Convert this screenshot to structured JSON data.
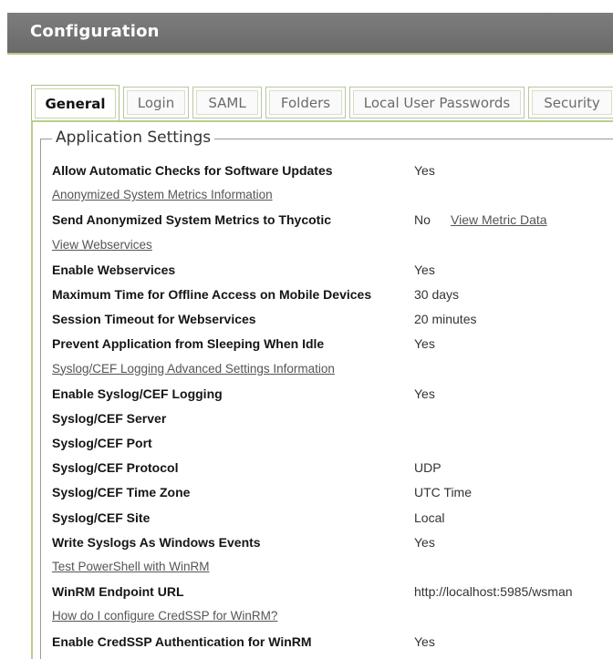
{
  "header": {
    "title": "Configuration"
  },
  "tabs": [
    {
      "label": "General",
      "active": true
    },
    {
      "label": "Login",
      "active": false
    },
    {
      "label": "SAML",
      "active": false
    },
    {
      "label": "Folders",
      "active": false
    },
    {
      "label": "Local User Passwords",
      "active": false
    },
    {
      "label": "Security",
      "active": false
    }
  ],
  "section": {
    "title": "Application Settings"
  },
  "settings": [
    {
      "label": "Allow Automatic Checks for Software Updates",
      "value": "Yes"
    },
    {
      "link": "Anonymized System Metrics Information"
    },
    {
      "label": "Send Anonymized System Metrics to Thycotic",
      "value": "No",
      "value_link": "View Metric Data"
    },
    {
      "link": "View Webservices"
    },
    {
      "label": "Enable Webservices",
      "value": "Yes"
    },
    {
      "label": "Maximum Time for Offline Access on Mobile Devices",
      "value": "30 days"
    },
    {
      "label": "Session Timeout for Webservices",
      "value": "20 minutes"
    },
    {
      "label": "Prevent Application from Sleeping When Idle",
      "value": "Yes"
    },
    {
      "link": "Syslog/CEF Logging Advanced Settings Information"
    },
    {
      "label": "Enable Syslog/CEF Logging",
      "value": "Yes"
    },
    {
      "label": "Syslog/CEF Server",
      "value": ""
    },
    {
      "label": "Syslog/CEF Port",
      "value": ""
    },
    {
      "label": "Syslog/CEF Protocol",
      "value": "UDP"
    },
    {
      "label": "Syslog/CEF Time Zone",
      "value": "UTC Time"
    },
    {
      "label": "Syslog/CEF Site",
      "value": "Local"
    },
    {
      "label": "Write Syslogs As Windows Events",
      "value": "Yes"
    },
    {
      "link": "Test PowerShell with WinRM"
    },
    {
      "label": "WinRM Endpoint URL",
      "value": "http://localhost:5985/wsman"
    },
    {
      "link": "How do I configure CredSSP for WinRM?"
    },
    {
      "label": "Enable CredSSP Authentication for WinRM",
      "value": "Yes"
    }
  ]
}
